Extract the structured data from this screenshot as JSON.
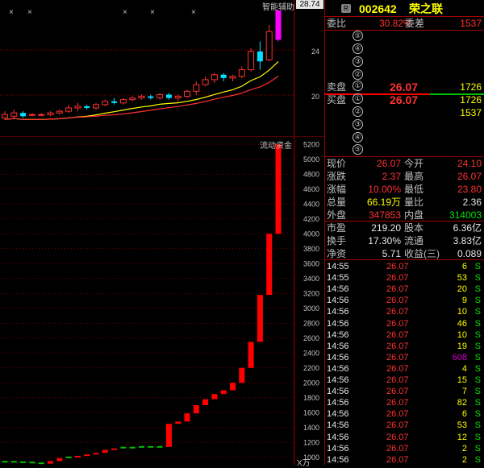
{
  "top_chart": {
    "indicator_label": "智能辅助",
    "indicator_value": "28.74",
    "price_ticks": [
      "24",
      "20"
    ],
    "candles": [
      {
        "o": 19.6,
        "c": 19.8,
        "h": 20.0,
        "l": 19.5,
        "up": true
      },
      {
        "o": 19.7,
        "c": 19.9,
        "h": 20.1,
        "l": 19.6,
        "up": true
      },
      {
        "o": 19.9,
        "c": 19.7,
        "h": 20.0,
        "l": 19.6,
        "up": false
      },
      {
        "o": 19.8,
        "c": 19.8,
        "h": 19.9,
        "l": 19.7,
        "up": true
      },
      {
        "o": 19.8,
        "c": 19.8,
        "h": 19.9,
        "l": 19.7,
        "up": true
      },
      {
        "o": 19.8,
        "c": 19.9,
        "h": 20.0,
        "l": 19.7,
        "up": true
      },
      {
        "o": 19.9,
        "c": 20.0,
        "h": 20.1,
        "l": 19.8,
        "up": true
      },
      {
        "o": 20.0,
        "c": 20.2,
        "h": 20.4,
        "l": 19.9,
        "up": true
      },
      {
        "o": 20.2,
        "c": 20.3,
        "h": 20.5,
        "l": 20.0,
        "up": true
      },
      {
        "o": 20.3,
        "c": 20.2,
        "h": 20.4,
        "l": 20.1,
        "up": true
      },
      {
        "o": 20.2,
        "c": 20.4,
        "h": 20.5,
        "l": 20.1,
        "up": true
      },
      {
        "o": 20.4,
        "c": 20.6,
        "h": 20.7,
        "l": 20.3,
        "up": true
      },
      {
        "o": 20.6,
        "c": 20.5,
        "h": 20.8,
        "l": 20.4,
        "up": true
      },
      {
        "o": 20.5,
        "c": 20.7,
        "h": 20.8,
        "l": 20.4,
        "up": true
      },
      {
        "o": 20.7,
        "c": 20.8,
        "h": 20.9,
        "l": 20.6,
        "up": true
      },
      {
        "o": 20.8,
        "c": 20.9,
        "h": 21.0,
        "l": 20.7,
        "up": true
      },
      {
        "o": 20.9,
        "c": 20.8,
        "h": 21.0,
        "l": 20.7,
        "up": true
      },
      {
        "o": 20.8,
        "c": 21.0,
        "h": 21.1,
        "l": 20.7,
        "up": true
      },
      {
        "o": 21.0,
        "c": 20.8,
        "h": 21.1,
        "l": 20.7,
        "up": true
      },
      {
        "o": 20.8,
        "c": 20.9,
        "h": 21.0,
        "l": 20.6,
        "up": true
      },
      {
        "o": 20.9,
        "c": 21.2,
        "h": 21.3,
        "l": 20.8,
        "up": true
      },
      {
        "o": 21.2,
        "c": 21.6,
        "h": 21.8,
        "l": 21.0,
        "up": true
      },
      {
        "o": 21.6,
        "c": 21.9,
        "h": 22.1,
        "l": 21.5,
        "up": true
      },
      {
        "o": 21.9,
        "c": 22.2,
        "h": 22.3,
        "l": 21.7,
        "up": true
      },
      {
        "o": 22.2,
        "c": 22.0,
        "h": 22.3,
        "l": 21.8,
        "up": false
      },
      {
        "o": 22.0,
        "c": 22.1,
        "h": 22.2,
        "l": 21.8,
        "up": true
      },
      {
        "o": 22.1,
        "c": 22.5,
        "h": 22.7,
        "l": 22.0,
        "up": true
      },
      {
        "o": 22.5,
        "c": 23.6,
        "h": 23.8,
        "l": 22.4,
        "up": true
      },
      {
        "o": 23.6,
        "c": 23.0,
        "h": 24.2,
        "l": 22.5,
        "up": true
      },
      {
        "o": 23.1,
        "c": 24.8,
        "h": 25.2,
        "l": 23.0,
        "up": false
      },
      {
        "o": 24.3,
        "c": 26.07,
        "h": 26.07,
        "l": 24.2,
        "up": true
      }
    ]
  },
  "bottom_chart": {
    "title": "流动资金",
    "unit": "万",
    "y_ticks": [
      "5200",
      "5000",
      "4800",
      "4600",
      "4400",
      "4200",
      "4000",
      "3800",
      "3600",
      "3400",
      "3200",
      "3000",
      "2800",
      "2600",
      "2400",
      "2200",
      "2000",
      "1800",
      "1600",
      "1400",
      "1200",
      "1000"
    ],
    "bars": [
      {
        "o": 930,
        "c": 940
      },
      {
        "o": 940,
        "c": 935
      },
      {
        "o": 935,
        "c": 930
      },
      {
        "o": 930,
        "c": 920
      },
      {
        "o": 920,
        "c": 915
      },
      {
        "o": 915,
        "c": 950
      },
      {
        "o": 950,
        "c": 990
      },
      {
        "o": 990,
        "c": 1000
      },
      {
        "o": 1000,
        "c": 1020
      },
      {
        "o": 1020,
        "c": 1040
      },
      {
        "o": 1040,
        "c": 1060
      },
      {
        "o": 1060,
        "c": 1100
      },
      {
        "o": 1100,
        "c": 1120
      },
      {
        "o": 1120,
        "c": 1130
      },
      {
        "o": 1130,
        "c": 1130
      },
      {
        "o": 1130,
        "c": 1140
      },
      {
        "o": 1140,
        "c": 1140
      },
      {
        "o": 1140,
        "c": 1140
      },
      {
        "o": 1140,
        "c": 1450
      },
      {
        "o": 1450,
        "c": 1480
      },
      {
        "o": 1480,
        "c": 1590
      },
      {
        "o": 1590,
        "c": 1700
      },
      {
        "o": 1700,
        "c": 1780
      },
      {
        "o": 1780,
        "c": 1850
      },
      {
        "o": 1850,
        "c": 1900
      },
      {
        "o": 1900,
        "c": 2000
      },
      {
        "o": 2000,
        "c": 2200
      },
      {
        "o": 2200,
        "c": 2550
      },
      {
        "o": 2550,
        "c": 3180
      },
      {
        "o": 3180,
        "c": 4000
      },
      {
        "o": 4000,
        "c": 5200
      }
    ],
    "bar_colors": {
      "up": "#ff0000",
      "flat": "#00c000"
    }
  },
  "quote": {
    "badge": "R",
    "code": "002642",
    "name": "荣之联",
    "wei_bi_label": "委比",
    "wei_bi": "30.82%",
    "wei_cha_label": "委差",
    "wei_cha": "1537",
    "sell_label": "卖盘",
    "buy_label": "买盘",
    "sell_levels": [
      "⑤",
      "④",
      "③",
      "②",
      "①"
    ],
    "sell_price": "26.07",
    "sell_vol": "1726",
    "buy_levels": [
      "①",
      "②",
      "③",
      "④",
      "⑤"
    ],
    "buy_price": "26.07",
    "buy_vols": [
      "1726",
      "1537"
    ],
    "stats": [
      {
        "l1": "现价",
        "v1": "26.07",
        "c1": "red",
        "l2": "今开",
        "v2": "24.10",
        "c2": "red"
      },
      {
        "l1": "涨跌",
        "v1": "2.37",
        "c1": "red",
        "l2": "最高",
        "v2": "26.07",
        "c2": "red"
      },
      {
        "l1": "涨幅",
        "v1": "10.00%",
        "c1": "red",
        "l2": "最低",
        "v2": "23.80",
        "c2": "red"
      },
      {
        "l1": "总量",
        "v1": "66.19万",
        "c1": "yel",
        "l2": "量比",
        "v2": "2.36",
        "c2": "wht"
      },
      {
        "l1": "外盘",
        "v1": "347853",
        "c1": "red",
        "l2": "内盘",
        "v2": "314003",
        "c2": "grn"
      }
    ],
    "stats2": [
      {
        "l1": "市盈",
        "v1": "219.20",
        "l2": "股本",
        "v2": "6.36亿"
      },
      {
        "l1": "换手",
        "v1": "17.30%",
        "l2": "流通",
        "v2": "3.83亿"
      },
      {
        "l1": "净资",
        "v1": "5.71",
        "l2": "收益(三)",
        "v2": "0.089"
      }
    ],
    "trades": [
      {
        "t": "14:55",
        "p": "26.07",
        "v": "6",
        "s": "S",
        "vc": "yel"
      },
      {
        "t": "14:55",
        "p": "26.07",
        "v": "53",
        "s": "S",
        "vc": "yel"
      },
      {
        "t": "14:56",
        "p": "26.07",
        "v": "20",
        "s": "S",
        "vc": "yel"
      },
      {
        "t": "14:56",
        "p": "26.07",
        "v": "9",
        "s": "S",
        "vc": "yel"
      },
      {
        "t": "14:56",
        "p": "26.07",
        "v": "10",
        "s": "S",
        "vc": "yel"
      },
      {
        "t": "14:56",
        "p": "26.07",
        "v": "46",
        "s": "S",
        "vc": "yel"
      },
      {
        "t": "14:56",
        "p": "26.07",
        "v": "10",
        "s": "S",
        "vc": "yel"
      },
      {
        "t": "14:56",
        "p": "26.07",
        "v": "19",
        "s": "S",
        "vc": "yel"
      },
      {
        "t": "14:56",
        "p": "26.07",
        "v": "608",
        "s": "S",
        "vc": "mag"
      },
      {
        "t": "14:56",
        "p": "26.07",
        "v": "4",
        "s": "S",
        "vc": "yel"
      },
      {
        "t": "14:56",
        "p": "26.07",
        "v": "15",
        "s": "S",
        "vc": "yel"
      },
      {
        "t": "14:56",
        "p": "26.07",
        "v": "7",
        "s": "S",
        "vc": "yel"
      },
      {
        "t": "14:56",
        "p": "26.07",
        "v": "82",
        "s": "S",
        "vc": "yel"
      },
      {
        "t": "14:56",
        "p": "26.07",
        "v": "6",
        "s": "S",
        "vc": "yel"
      },
      {
        "t": "14:56",
        "p": "26.07",
        "v": "53",
        "s": "S",
        "vc": "yel"
      },
      {
        "t": "14:56",
        "p": "26.07",
        "v": "12",
        "s": "S",
        "vc": "yel"
      },
      {
        "t": "14:56",
        "p": "26.07",
        "v": "2",
        "s": "S",
        "vc": "yel"
      },
      {
        "t": "14:56",
        "p": "26.07",
        "v": "2",
        "s": "S",
        "vc": "yel"
      }
    ]
  }
}
